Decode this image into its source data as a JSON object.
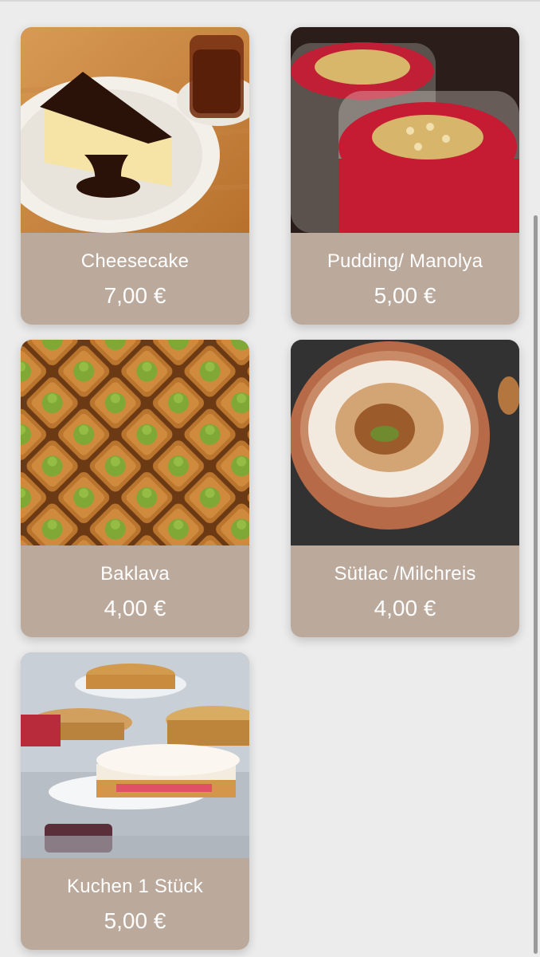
{
  "menu": {
    "items": [
      {
        "name": "Cheesecake",
        "price": "7,00 €",
        "photo": "cheesecake-photo"
      },
      {
        "name": "Pudding/ Manolya",
        "price": "5,00 €",
        "photo": "pudding-photo"
      },
      {
        "name": "Baklava",
        "price": "4,00 €",
        "photo": "baklava-photo"
      },
      {
        "name": "Sütlac /Milchreis",
        "price": "4,00 €",
        "photo": "sutlac-photo"
      },
      {
        "name": "Kuchen 1 Stück",
        "price": "5,00 €",
        "photo": "kuchen-photo"
      }
    ]
  },
  "theme": {
    "background": "#ececec",
    "card_info_color": "#bba99c",
    "text_color": "#ffffff"
  }
}
